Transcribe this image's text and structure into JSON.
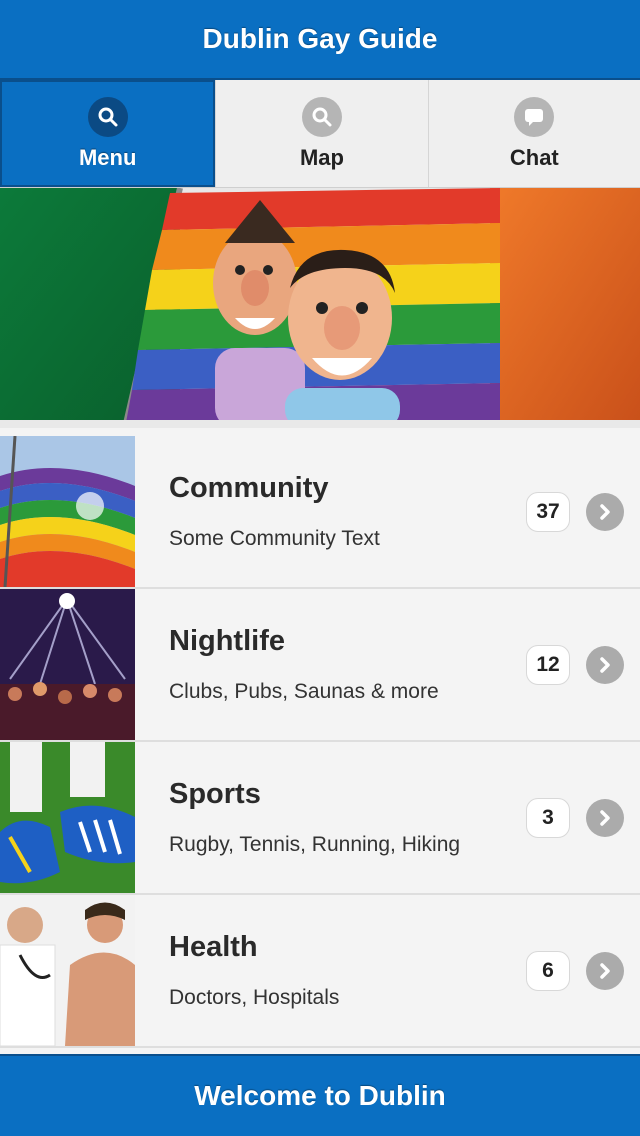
{
  "header": {
    "title": "Dublin Gay Guide"
  },
  "tabs": [
    {
      "label": "Menu",
      "icon": "search-icon",
      "active": true
    },
    {
      "label": "Map",
      "icon": "search-icon",
      "active": false
    },
    {
      "label": "Chat",
      "icon": "chat-bubble-icon",
      "active": false
    }
  ],
  "list": [
    {
      "title": "Community",
      "subtitle": "Some Community Text",
      "count": "37",
      "thumb": "rainbow-flag-photo"
    },
    {
      "title": "Nightlife",
      "subtitle": "Clubs, Pubs, Saunas & more",
      "count": "12",
      "thumb": "nightclub-crowd-photo"
    },
    {
      "title": "Sports",
      "subtitle": "Rugby, Tennis, Running, Hiking",
      "count": "3",
      "thumb": "football-boots-photo"
    },
    {
      "title": "Health",
      "subtitle": "Doctors, Hospitals",
      "count": "6",
      "thumb": "doctor-patient-photo"
    }
  ],
  "footer": {
    "title": "Welcome to Dublin"
  },
  "colors": {
    "brand_blue": "#0a6fc2",
    "dark_blue": "#0a4f8c",
    "arrow_gray": "#ababab"
  }
}
